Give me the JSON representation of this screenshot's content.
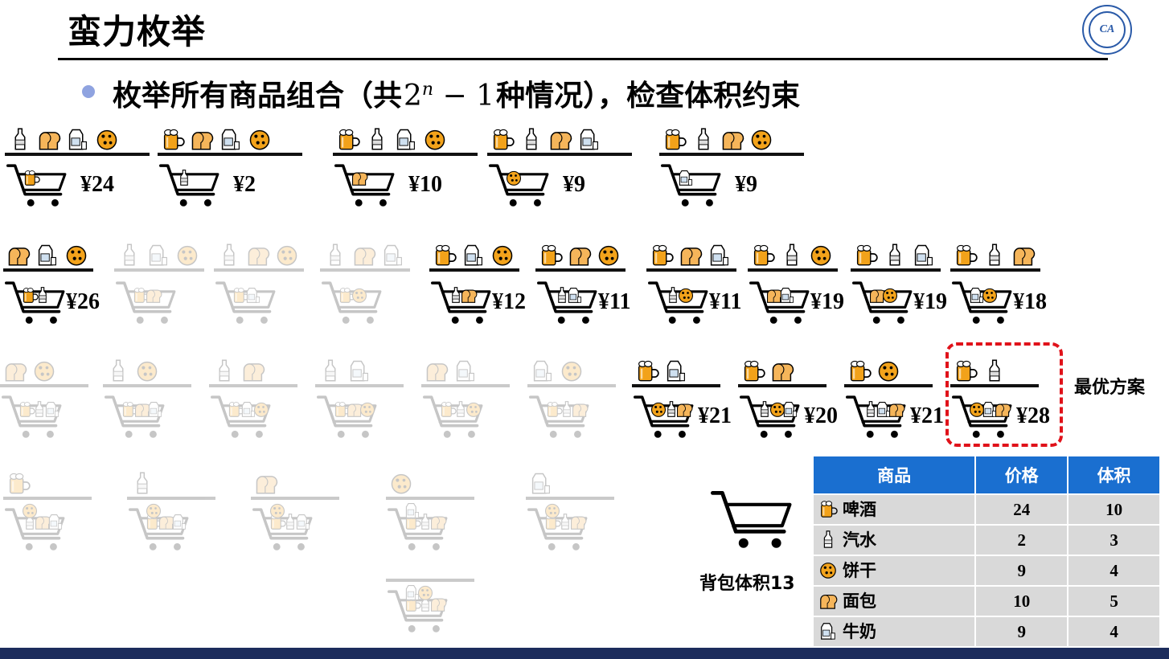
{
  "title": "蛮力枚举",
  "logo_alt": "logo-icon",
  "bullet": {
    "prefix": "枚举所有商品组合（共",
    "math_base": "2",
    "math_exp": "n",
    "math_rest": " − 1",
    "suffix": "种情况），检查体积约束"
  },
  "row1": [
    {
      "shelf": [
        "bottle",
        "bread",
        "milk",
        "cookie"
      ],
      "cart": [
        "beer"
      ],
      "price": "¥24"
    },
    {
      "shelf": [
        "beer",
        "bread",
        "milk",
        "cookie"
      ],
      "cart": [
        "bottle"
      ],
      "price": "¥2"
    },
    {
      "shelf": [
        "beer",
        "bottle",
        "milk",
        "cookie"
      ],
      "cart": [
        "bread"
      ],
      "price": "¥10"
    },
    {
      "shelf": [
        "beer",
        "bottle",
        "bread",
        "milk"
      ],
      "cart": [
        "cookie"
      ],
      "price": "¥9"
    },
    {
      "shelf": [
        "beer",
        "bottle",
        "bread",
        "cookie"
      ],
      "cart": [
        "milk"
      ],
      "price": "¥9"
    }
  ],
  "row2": [
    {
      "shelf": [
        "bread",
        "milk",
        "cookie"
      ],
      "cart": [
        "beer",
        "bottle"
      ],
      "price": "¥26",
      "faded": false
    },
    {
      "shelf": [
        "bottle",
        "milk",
        "cookie"
      ],
      "cart": [
        "beer",
        "bread"
      ],
      "price": "",
      "faded": true
    },
    {
      "shelf": [
        "bottle",
        "bread",
        "cookie"
      ],
      "cart": [
        "beer",
        "milk"
      ],
      "price": "",
      "faded": true
    },
    {
      "shelf": [
        "bottle",
        "bread",
        "milk"
      ],
      "cart": [
        "beer",
        "cookie"
      ],
      "price": "",
      "faded": true
    },
    {
      "shelf": [
        "beer",
        "milk",
        "cookie"
      ],
      "cart": [
        "bottle",
        "bread"
      ],
      "price": "¥12",
      "faded": false
    },
    {
      "shelf": [
        "beer",
        "bread",
        "cookie"
      ],
      "cart": [
        "bottle",
        "milk"
      ],
      "price": "¥11",
      "faded": false
    },
    {
      "shelf": [
        "beer",
        "bread",
        "milk"
      ],
      "cart": [
        "bottle",
        "cookie"
      ],
      "price": "¥11",
      "faded": false
    },
    {
      "shelf": [
        "beer",
        "bottle",
        "cookie"
      ],
      "cart": [
        "bread",
        "milk"
      ],
      "price": "¥19",
      "faded": false
    },
    {
      "shelf": [
        "beer",
        "bottle",
        "milk"
      ],
      "cart": [
        "bread",
        "cookie"
      ],
      "price": "¥19",
      "faded": false
    },
    {
      "shelf": [
        "beer",
        "bottle",
        "bread"
      ],
      "cart": [
        "milk",
        "cookie"
      ],
      "price": "¥18",
      "faded": false
    }
  ],
  "row3": [
    {
      "shelf": [
        "bread",
        "cookie"
      ],
      "cart": [
        "beer",
        "bottle",
        "milk"
      ],
      "price": "",
      "faded": true
    },
    {
      "shelf": [
        "bottle",
        "cookie"
      ],
      "cart": [
        "beer",
        "bread",
        "milk"
      ],
      "price": "",
      "faded": true
    },
    {
      "shelf": [
        "bottle",
        "bread"
      ],
      "cart": [
        "beer",
        "milk",
        "cookie"
      ],
      "price": "",
      "faded": true
    },
    {
      "shelf": [
        "bottle",
        "milk"
      ],
      "cart": [
        "beer",
        "bread",
        "cookie"
      ],
      "price": "",
      "faded": true
    },
    {
      "shelf": [
        "bread",
        "milk"
      ],
      "cart": [
        "beer",
        "bottle",
        "cookie"
      ],
      "price": "",
      "faded": true
    },
    {
      "shelf": [
        "milk",
        "cookie"
      ],
      "cart": [
        "beer",
        "bottle",
        "bread"
      ],
      "price": "",
      "faded": true
    },
    {
      "shelf": [
        "beer",
        "milk"
      ],
      "cart": [
        "cookie",
        "bottle",
        "bread"
      ],
      "price": "¥21",
      "faded": false
    },
    {
      "shelf": [
        "beer",
        "bread"
      ],
      "cart": [
        "bottle",
        "cookie",
        "milk"
      ],
      "price": "¥20",
      "faded": false
    },
    {
      "shelf": [
        "beer",
        "cookie"
      ],
      "cart": [
        "bottle",
        "milk",
        "bread"
      ],
      "price": "¥21",
      "faded": false
    },
    {
      "shelf": [
        "beer",
        "bottle"
      ],
      "cart": [
        "cookie",
        "milk",
        "bread"
      ],
      "price": "¥28",
      "faded": false
    }
  ],
  "row4": [
    {
      "shelf": [
        "beer"
      ],
      "cart": [
        "bottle",
        "bread",
        "milk",
        "cookie"
      ],
      "faded": true
    },
    {
      "shelf": [
        "bottle"
      ],
      "cart": [
        "beer",
        "bread",
        "milk",
        "cookie"
      ],
      "faded": true
    },
    {
      "shelf": [
        "bread"
      ],
      "cart": [
        "beer",
        "bottle",
        "milk",
        "cookie"
      ],
      "faded": true
    },
    {
      "shelf": [
        "cookie"
      ],
      "cart": [
        "beer",
        "bottle",
        "bread",
        "milk"
      ],
      "faded": true
    },
    {
      "shelf": [
        "milk"
      ],
      "cart": [
        "beer",
        "bottle",
        "bread",
        "cookie"
      ],
      "faded": true
    }
  ],
  "row5": {
    "shelf": [],
    "cart": [
      "beer",
      "bottle",
      "bread",
      "milk",
      "cookie"
    ],
    "faded": true
  },
  "optimal_label": "最优方案",
  "capacity_label": "背包体积13",
  "table": {
    "headers": [
      "商品",
      "价格",
      "体积"
    ],
    "rows": [
      {
        "icon": "beer",
        "name": "啤酒",
        "price": "24",
        "volume": "10"
      },
      {
        "icon": "bottle",
        "name": "汽水",
        "price": "2",
        "volume": "3"
      },
      {
        "icon": "cookie",
        "name": "饼干",
        "price": "9",
        "volume": "4"
      },
      {
        "icon": "bread",
        "name": "面包",
        "price": "10",
        "volume": "5"
      },
      {
        "icon": "milk",
        "name": "牛奶",
        "price": "9",
        "volume": "4"
      }
    ]
  },
  "colors": {
    "accent_blue": "#1a6fd0",
    "optimal_red": "#e0121a",
    "beer": "#f2a21a",
    "bread": "#f5b55a",
    "cookie": "#f3a31b"
  }
}
